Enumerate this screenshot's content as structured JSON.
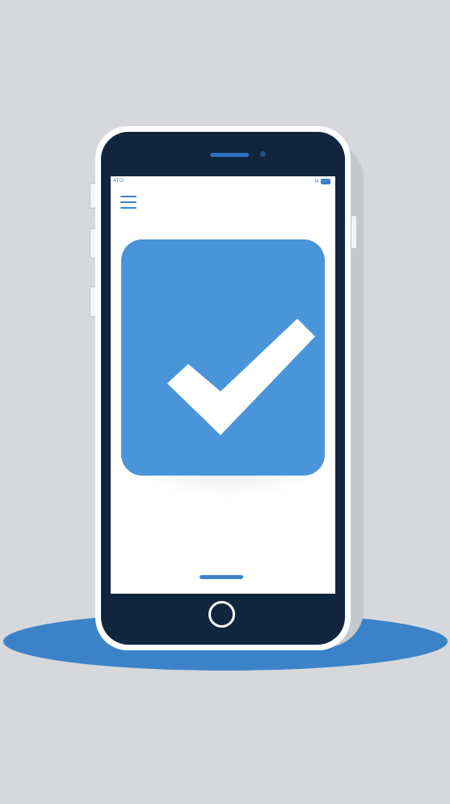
{
  "status_bar": {
    "left_text": "ATO ",
    "signal_glyph": "lll",
    "battery_icon": "battery-icon"
  },
  "menu": {
    "icon": "hamburger-menu-icon"
  },
  "main": {
    "check_icon": "checkmark-icon",
    "card_color": "#4a95d9",
    "check_color": "#ffffff"
  },
  "colors": {
    "background": "#d6d8dc",
    "phone_body": "#11253f",
    "accent": "#3c82c9"
  }
}
